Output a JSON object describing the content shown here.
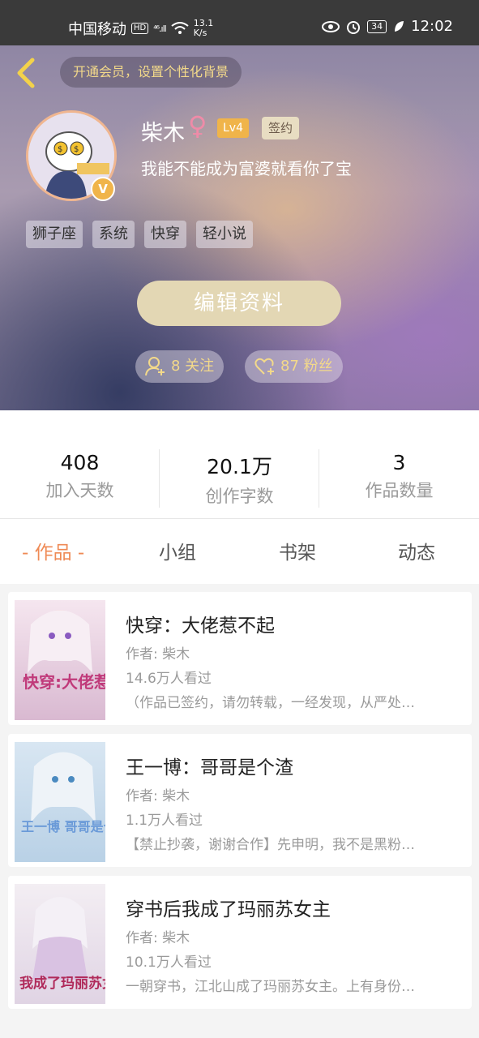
{
  "status_bar": {
    "carrier": "中国移动",
    "hd": "HD",
    "signal": "⁴⁶.ıll",
    "speed": "13.1\nK/s",
    "battery": "34",
    "time": "12:02"
  },
  "header": {
    "vip_banner": "开通会员，设置个性化背景",
    "username": "柴木",
    "gender_symbol": "♀",
    "level": "Lv4",
    "signed_badge": "签约",
    "bio": "我能不能成为富婆就看你了宝",
    "tags": [
      "狮子座",
      "系统",
      "快穿",
      "轻小说"
    ],
    "edit_button": "编辑资料",
    "following": "8 关注",
    "followers": "87 粉丝",
    "v_badge": "V"
  },
  "stats": [
    {
      "num": "408",
      "label": "加入天数"
    },
    {
      "num": "20.1万",
      "label": "创作字数"
    },
    {
      "num": "3",
      "label": "作品数量"
    }
  ],
  "tabs": [
    "- 作品 -",
    "小组",
    "书架",
    "动态"
  ],
  "works": [
    {
      "title": "快穿：大佬惹不起",
      "author": "作者: 柴木",
      "views": "14.6万人看过",
      "desc": "（作品已签约，请勿转载，一经发现，从严处…",
      "cover_text": "快穿:大佬惹不起"
    },
    {
      "title": "王一博：哥哥是个渣",
      "author": "作者: 柴木",
      "views": "1.1万人看过",
      "desc": "【禁止抄袭，谢谢合作】先申明，我不是黑粉…",
      "cover_text": "王一博 哥哥是个渣"
    },
    {
      "title": "穿书后我成了玛丽苏女主",
      "author": "作者: 柴木",
      "views": "10.1万人看过",
      "desc": "一朝穿书，江北山成了玛丽苏女主。上有身份…",
      "cover_text": "我成了玛丽苏女主"
    }
  ],
  "colors": {
    "accent": "#ef8a55",
    "gold": "#f3d98a",
    "level_badge": "#f0b44a"
  }
}
